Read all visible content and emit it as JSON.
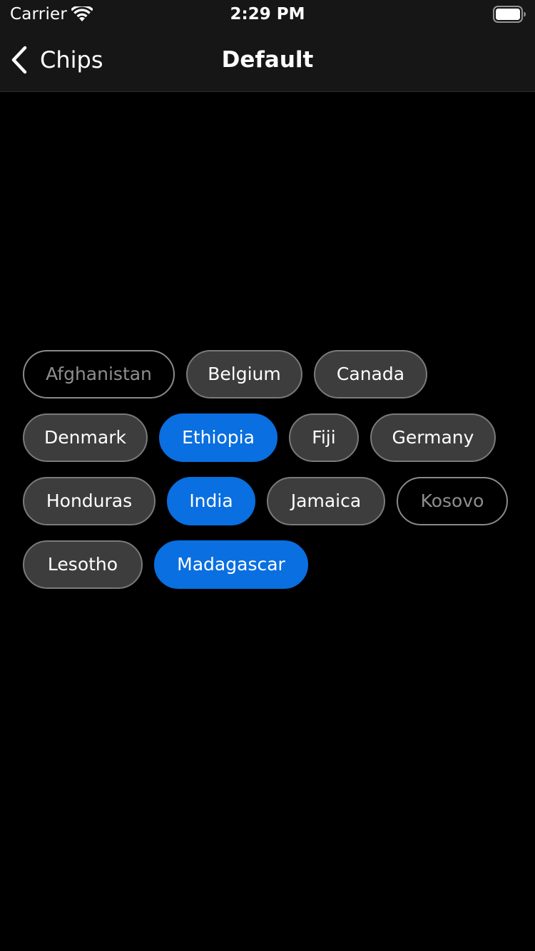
{
  "status_bar": {
    "carrier": "Carrier",
    "time": "2:29 PM",
    "icons": [
      "wifi-icon",
      "battery-icon"
    ]
  },
  "nav": {
    "back_label": "Chips",
    "back_icon": "chevron-left-icon",
    "title": "Default"
  },
  "colors": {
    "background": "#000000",
    "bar_background": "#161616",
    "chip_background": "#3d3d3d",
    "chip_selected": "#0a6fe0",
    "chip_disabled_text": "#8e8e8e"
  },
  "chips": [
    {
      "label": "Afghanistan",
      "state": "disabled"
    },
    {
      "label": "Belgium",
      "state": "default"
    },
    {
      "label": "Canada",
      "state": "default"
    },
    {
      "label": "Denmark",
      "state": "default"
    },
    {
      "label": "Ethiopia",
      "state": "selected"
    },
    {
      "label": "Fiji",
      "state": "default"
    },
    {
      "label": "Germany",
      "state": "default"
    },
    {
      "label": "Honduras",
      "state": "default"
    },
    {
      "label": "India",
      "state": "selected"
    },
    {
      "label": "Jamaica",
      "state": "default"
    },
    {
      "label": "Kosovo",
      "state": "disabled"
    },
    {
      "label": "Lesotho",
      "state": "default"
    },
    {
      "label": "Madagascar",
      "state": "selected"
    }
  ]
}
